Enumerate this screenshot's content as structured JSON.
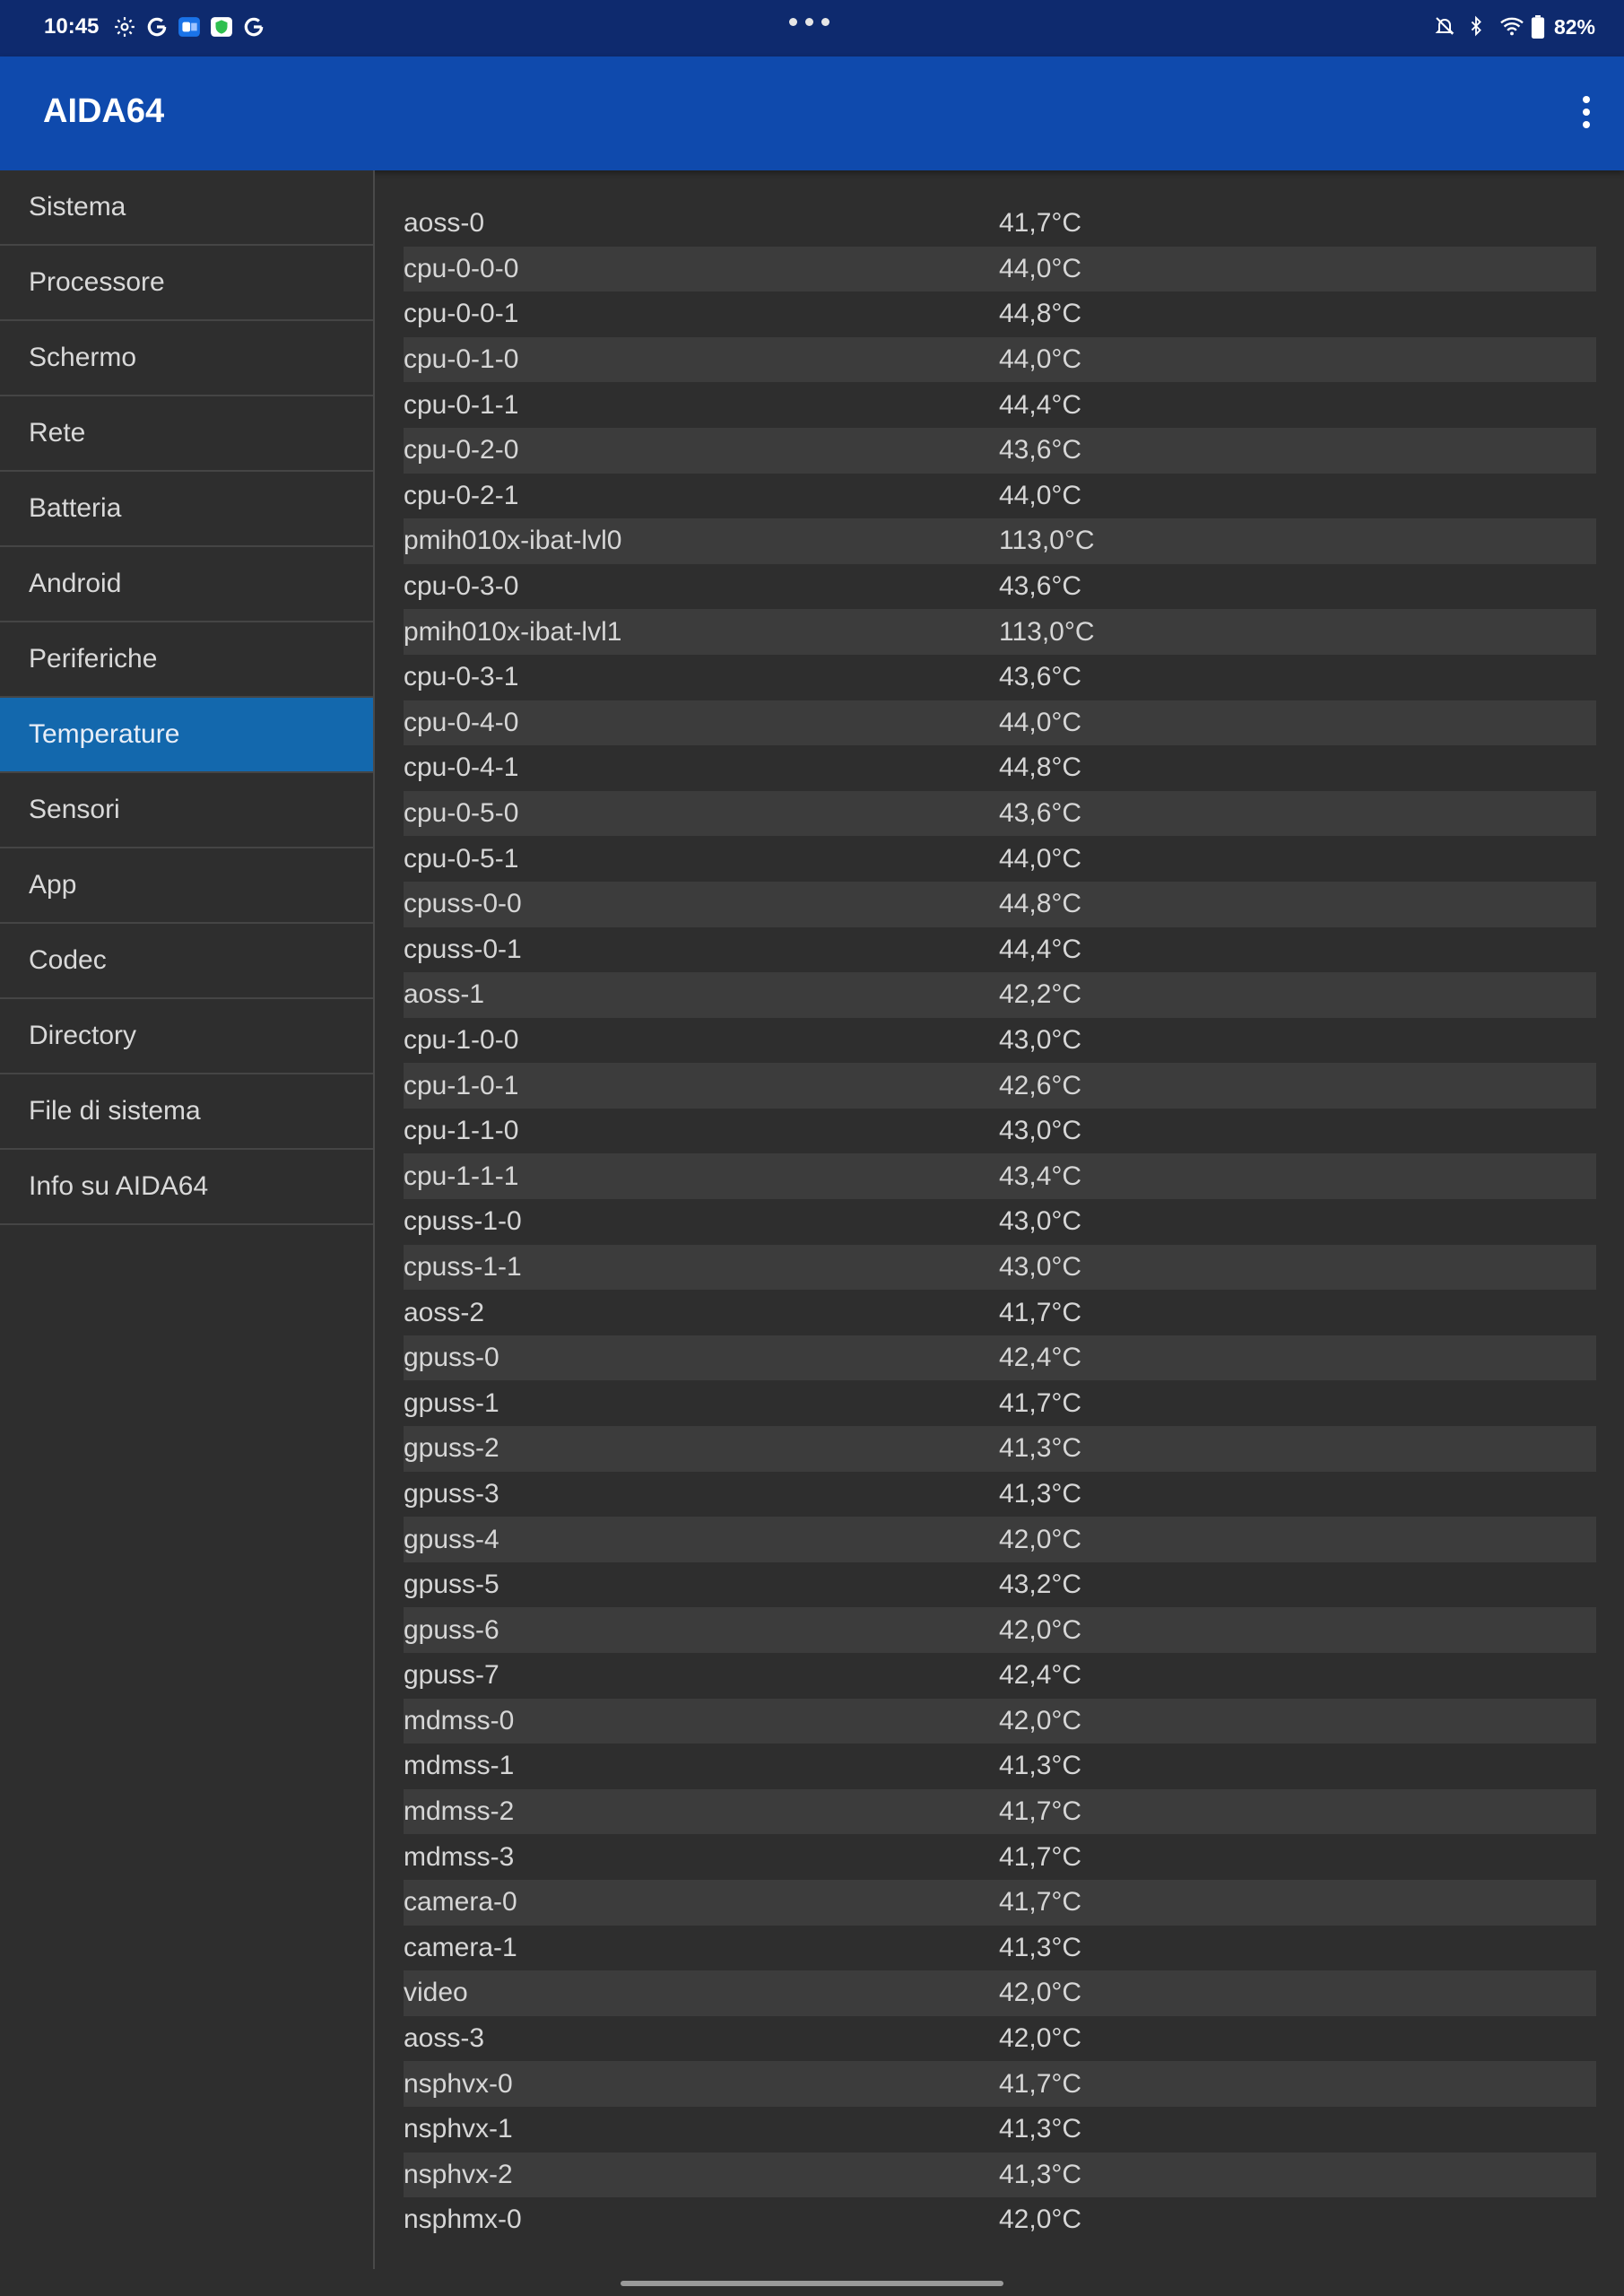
{
  "status_bar": {
    "time": "10:45",
    "battery": "82%",
    "left_icons": [
      "settings-icon",
      "google-icon",
      "outlook-icon",
      "shield-icon",
      "google-icon"
    ],
    "right_icons": [
      "bell-off-icon",
      "bluetooth-icon",
      "wifi-icon",
      "battery-icon"
    ]
  },
  "app_bar": {
    "title": "AIDA64",
    "accent": "#0f4aad"
  },
  "sidebar": {
    "items": [
      {
        "label": "Sistema",
        "active": false
      },
      {
        "label": "Processore",
        "active": false
      },
      {
        "label": "Schermo",
        "active": false
      },
      {
        "label": "Rete",
        "active": false
      },
      {
        "label": "Batteria",
        "active": false
      },
      {
        "label": "Android",
        "active": false
      },
      {
        "label": "Periferiche",
        "active": false
      },
      {
        "label": "Temperature",
        "active": true
      },
      {
        "label": "Sensori",
        "active": false
      },
      {
        "label": "App",
        "active": false
      },
      {
        "label": "Codec",
        "active": false
      },
      {
        "label": "Directory",
        "active": false
      },
      {
        "label": "File di sistema",
        "active": false
      },
      {
        "label": "Info su AIDA64",
        "active": false
      }
    ],
    "active_color": "#1368ad"
  },
  "temperatures": [
    {
      "name": "aoss-0",
      "value": "41,7°C"
    },
    {
      "name": "cpu-0-0-0",
      "value": "44,0°C"
    },
    {
      "name": "cpu-0-0-1",
      "value": "44,8°C"
    },
    {
      "name": "cpu-0-1-0",
      "value": "44,0°C"
    },
    {
      "name": "cpu-0-1-1",
      "value": "44,4°C"
    },
    {
      "name": "cpu-0-2-0",
      "value": "43,6°C"
    },
    {
      "name": "cpu-0-2-1",
      "value": "44,0°C"
    },
    {
      "name": "pmih010x-ibat-lvl0",
      "value": "113,0°C"
    },
    {
      "name": "cpu-0-3-0",
      "value": "43,6°C"
    },
    {
      "name": "pmih010x-ibat-lvl1",
      "value": "113,0°C"
    },
    {
      "name": "cpu-0-3-1",
      "value": "43,6°C"
    },
    {
      "name": "cpu-0-4-0",
      "value": "44,0°C"
    },
    {
      "name": "cpu-0-4-1",
      "value": "44,8°C"
    },
    {
      "name": "cpu-0-5-0",
      "value": "43,6°C"
    },
    {
      "name": "cpu-0-5-1",
      "value": "44,0°C"
    },
    {
      "name": "cpuss-0-0",
      "value": "44,8°C"
    },
    {
      "name": "cpuss-0-1",
      "value": "44,4°C"
    },
    {
      "name": "aoss-1",
      "value": "42,2°C"
    },
    {
      "name": "cpu-1-0-0",
      "value": "43,0°C"
    },
    {
      "name": "cpu-1-0-1",
      "value": "42,6°C"
    },
    {
      "name": "cpu-1-1-0",
      "value": "43,0°C"
    },
    {
      "name": "cpu-1-1-1",
      "value": "43,4°C"
    },
    {
      "name": "cpuss-1-0",
      "value": "43,0°C"
    },
    {
      "name": "cpuss-1-1",
      "value": "43,0°C"
    },
    {
      "name": "aoss-2",
      "value": "41,7°C"
    },
    {
      "name": "gpuss-0",
      "value": "42,4°C"
    },
    {
      "name": "gpuss-1",
      "value": "41,7°C"
    },
    {
      "name": "gpuss-2",
      "value": "41,3°C"
    },
    {
      "name": "gpuss-3",
      "value": "41,3°C"
    },
    {
      "name": "gpuss-4",
      "value": "42,0°C"
    },
    {
      "name": "gpuss-5",
      "value": "43,2°C"
    },
    {
      "name": "gpuss-6",
      "value": "42,0°C"
    },
    {
      "name": "gpuss-7",
      "value": "42,4°C"
    },
    {
      "name": "mdmss-0",
      "value": "42,0°C"
    },
    {
      "name": "mdmss-1",
      "value": "41,3°C"
    },
    {
      "name": "mdmss-2",
      "value": "41,7°C"
    },
    {
      "name": "mdmss-3",
      "value": "41,7°C"
    },
    {
      "name": "camera-0",
      "value": "41,7°C"
    },
    {
      "name": "camera-1",
      "value": "41,3°C"
    },
    {
      "name": "video",
      "value": "42,0°C"
    },
    {
      "name": "aoss-3",
      "value": "42,0°C"
    },
    {
      "name": "nsphvx-0",
      "value": "41,7°C"
    },
    {
      "name": "nsphvx-1",
      "value": "41,3°C"
    },
    {
      "name": "nsphvx-2",
      "value": "41,3°C"
    },
    {
      "name": "nsphmx-0",
      "value": "42,0°C"
    }
  ]
}
